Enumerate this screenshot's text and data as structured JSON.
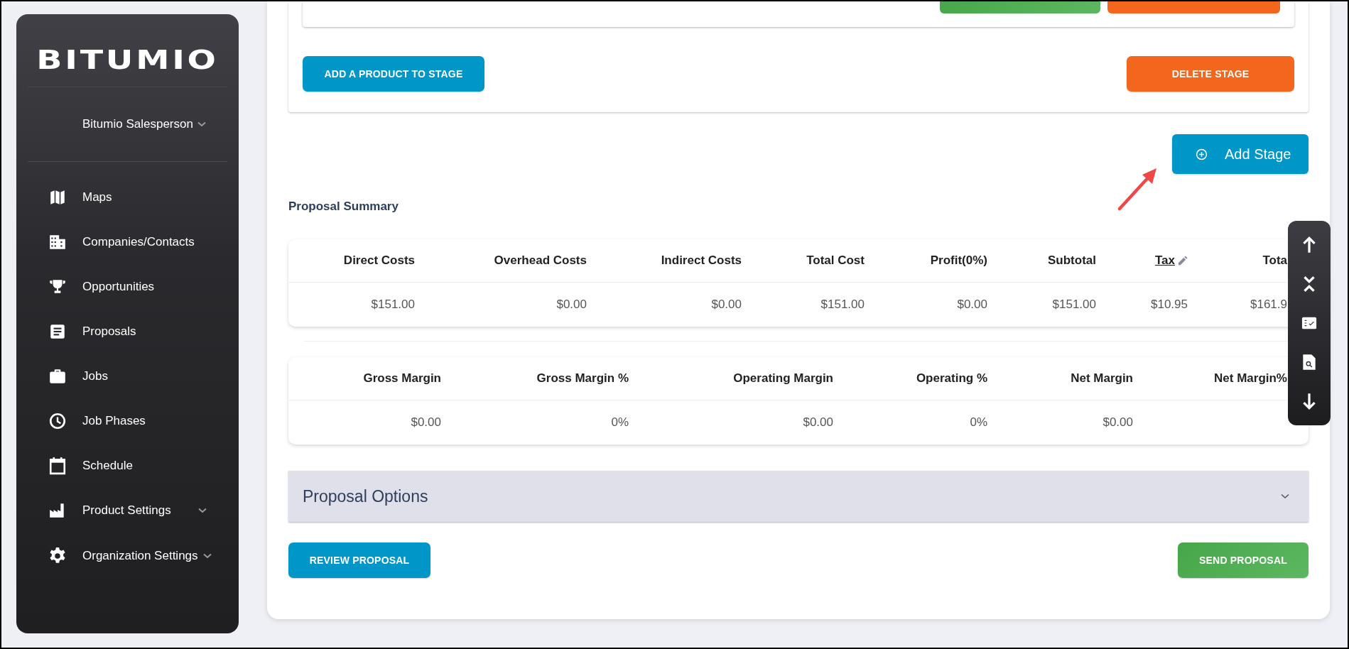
{
  "sidebar": {
    "logo": "BITUMIO",
    "user": {
      "name": "Bitumio Salesperson",
      "expandable": true
    },
    "items": [
      {
        "label": "Maps",
        "kind": "map",
        "expandable": false
      },
      {
        "label": "Companies/Contacts",
        "kind": "building",
        "expandable": false
      },
      {
        "label": "Opportunities",
        "kind": "trophy",
        "expandable": false
      },
      {
        "label": "Proposals",
        "kind": "document",
        "expandable": false
      },
      {
        "label": "Jobs",
        "kind": "briefcase",
        "expandable": false
      },
      {
        "label": "Job Phases",
        "kind": "clock",
        "expandable": false
      },
      {
        "label": "Schedule",
        "kind": "calendar",
        "expandable": false
      },
      {
        "label": "Product Settings",
        "kind": "factory",
        "expandable": true
      },
      {
        "label": "Organization Settings",
        "kind": "gear",
        "expandable": true
      }
    ]
  },
  "stage": {
    "top_buttons": [
      {
        "kind": "success"
      },
      {
        "kind": "danger"
      }
    ],
    "buttons": [
      {
        "label": "ADD A PRODUCT TO STAGE",
        "kind": "primary"
      },
      {
        "label": "DELETE STAGE",
        "kind": "danger"
      }
    ]
  },
  "add_stage_button": {
    "label": "Add Stage"
  },
  "summary": {
    "title": "Proposal Summary",
    "tables": [
      {
        "columns": [
          {
            "label": "Direct Costs",
            "editable": false
          },
          {
            "label": "Overhead Costs",
            "editable": false
          },
          {
            "label": "Indirect Costs",
            "editable": false
          },
          {
            "label": "Total Cost",
            "editable": false
          },
          {
            "label": "Profit(0%)",
            "editable": false
          },
          {
            "label": "Subtotal",
            "editable": false
          },
          {
            "label": "Tax",
            "editable": true
          },
          {
            "label": "Tota",
            "editable": false
          }
        ],
        "rows": [
          [
            "$151.00",
            "$0.00",
            "$0.00",
            "$151.00",
            "$0.00",
            "$151.00",
            "$10.95",
            "$161.9"
          ]
        ]
      },
      {
        "columns": [
          {
            "label": "Gross Margin",
            "editable": false
          },
          {
            "label": "Gross Margin %",
            "editable": false
          },
          {
            "label": "Operating Margin",
            "editable": false
          },
          {
            "label": "Operating %",
            "editable": false
          },
          {
            "label": "Net Margin",
            "editable": false
          },
          {
            "label": "Net Margin%",
            "editable": false
          }
        ],
        "rows": [
          [
            "$0.00",
            "0%",
            "$0.00",
            "0%",
            "$0.00",
            ""
          ]
        ]
      }
    ]
  },
  "proposal_options": {
    "title": "Proposal Options",
    "expanded": false
  },
  "footer_buttons": [
    {
      "label": "REVIEW PROPOSAL",
      "kind": "primary"
    },
    {
      "label": "SEND PROPOSAL",
      "kind": "success"
    }
  ],
  "scroll_toolbar": {
    "items": [
      {
        "kind": "up"
      },
      {
        "kind": "collapse"
      },
      {
        "kind": "checklist"
      },
      {
        "kind": "file-search"
      },
      {
        "kind": "down"
      }
    ]
  }
}
